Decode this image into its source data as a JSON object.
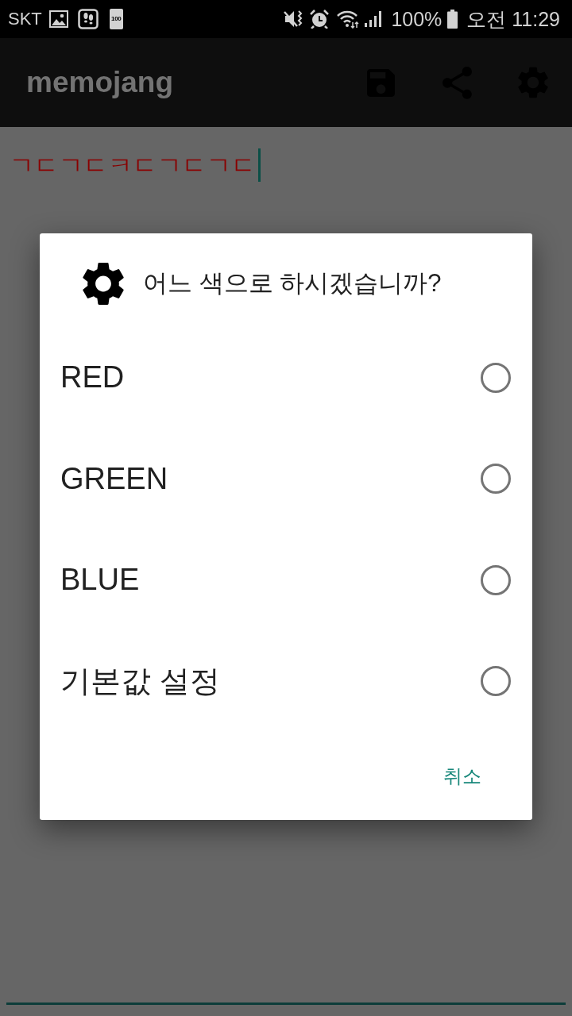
{
  "status_bar": {
    "carrier": "SKT",
    "notification_badge": "100",
    "battery_percent": "100%",
    "time": "오전 11:29"
  },
  "app_bar": {
    "title": "memojang"
  },
  "memo": {
    "text": "ㄱㄷㄱㄷㅋㄷㄱㄷㄱㄷ"
  },
  "dialog": {
    "title": "어느 색으로 하시겠습니까?",
    "options": [
      {
        "label": "RED",
        "selected": false
      },
      {
        "label": "GREEN",
        "selected": false
      },
      {
        "label": "BLUE",
        "selected": false
      },
      {
        "label": "기본값 설정",
        "selected": false
      }
    ],
    "cancel_button": "취소"
  }
}
